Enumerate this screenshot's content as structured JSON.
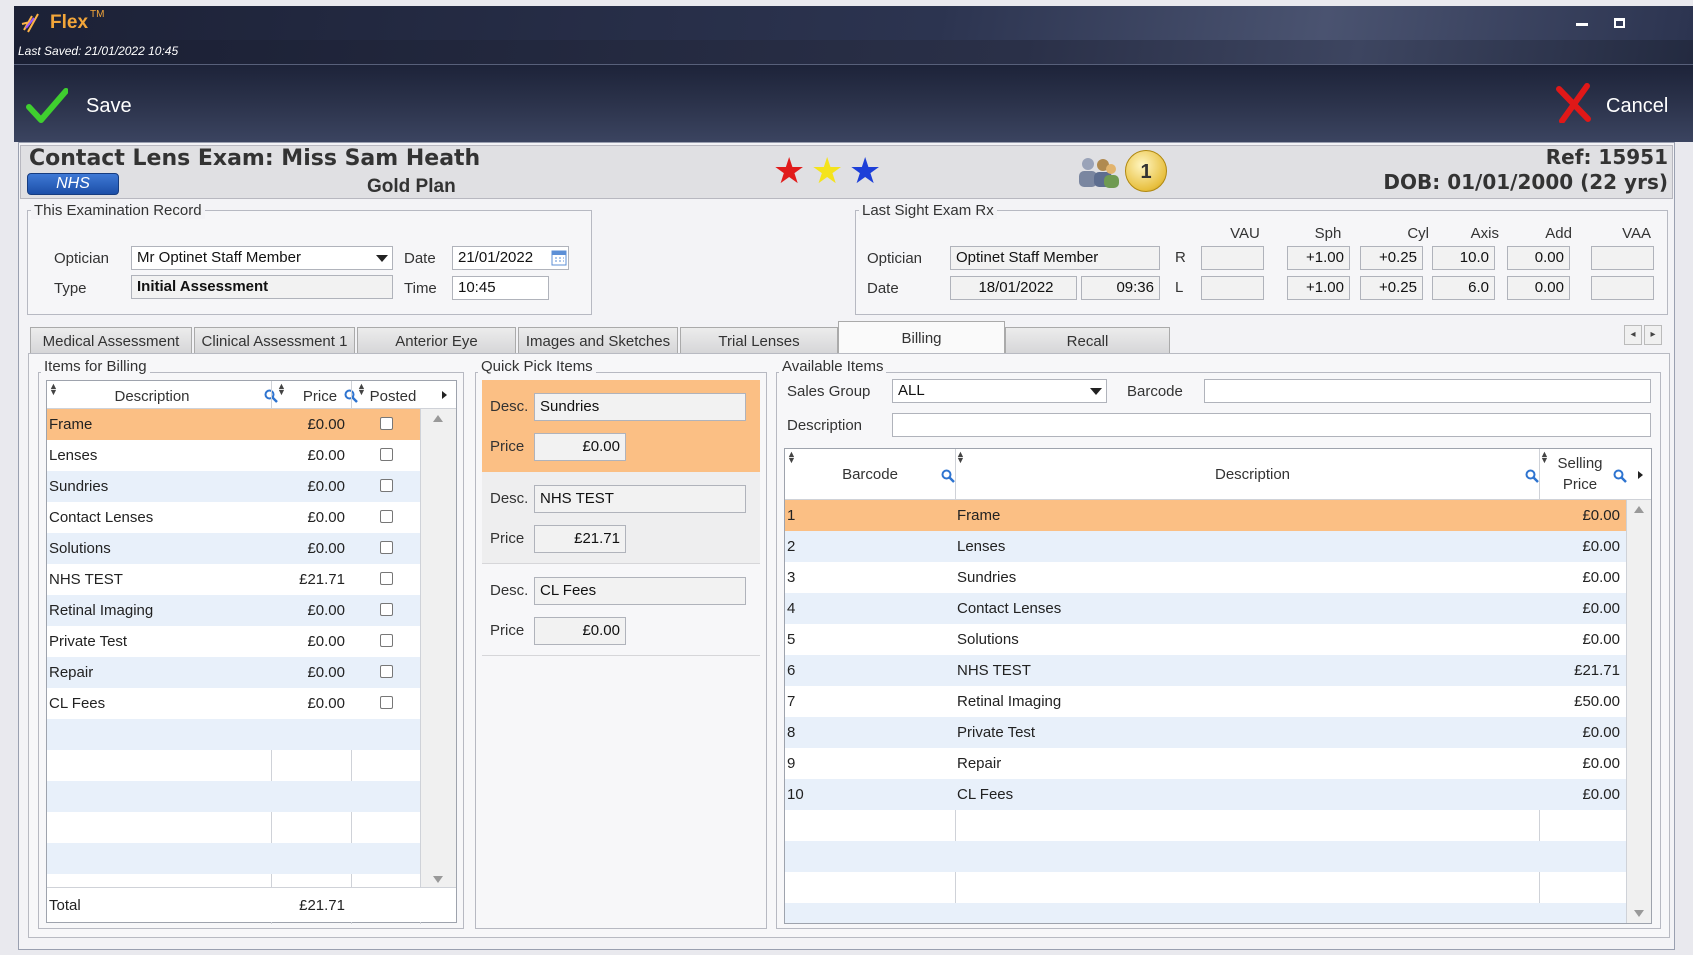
{
  "app": {
    "name": "Flex",
    "tm": "TM",
    "last_saved": "Last Saved: 21/01/2022 10:45"
  },
  "toolbar": {
    "save_label": "Save",
    "cancel_label": "Cancel"
  },
  "header": {
    "title": "Contact Lens Exam: Miss Sam Heath",
    "nhs_badge": "NHS",
    "plan": "Gold Plan",
    "alert_count": "1",
    "ref": "Ref: 15951",
    "dob": "DOB: 01/01/2000 (22 yrs)"
  },
  "exam_record": {
    "title": "This Examination Record",
    "optician_label": "Optician",
    "optician_value": "Mr Optinet Staff Member",
    "type_label": "Type",
    "type_value": "Initial Assessment",
    "date_label": "Date",
    "date_value": "21/01/2022",
    "time_label": "Time",
    "time_value": "10:45"
  },
  "sight_rx": {
    "title": "Last Sight Exam Rx",
    "optician_label": "Optician",
    "optician_value": "Optinet Staff Member",
    "date_label": "Date",
    "date_value": "18/01/2022",
    "time_value": "09:36",
    "columns": [
      "VAU",
      "Sph",
      "Cyl",
      "Axis",
      "Add",
      "VAA"
    ],
    "right": {
      "label": "R",
      "vau": "",
      "sph": "+1.00",
      "cyl": "+0.25",
      "axis": "10.0",
      "add": "0.00",
      "vaa": ""
    },
    "left": {
      "label": "L",
      "vau": "",
      "sph": "+1.00",
      "cyl": "+0.25",
      "axis": "6.0",
      "add": "0.00",
      "vaa": ""
    }
  },
  "tabs": [
    "Medical Assessment",
    "Clinical Assessment 1",
    "Anterior Eye",
    "Images and Sketches",
    "Trial Lenses",
    "Billing",
    "Recall"
  ],
  "billing": {
    "title": "Items for Billing",
    "headers": {
      "description": "Description",
      "price": "Price",
      "posted": "Posted"
    },
    "rows": [
      {
        "desc": "Frame",
        "price": "£0.00"
      },
      {
        "desc": "Lenses",
        "price": "£0.00"
      },
      {
        "desc": "Sundries",
        "price": "£0.00"
      },
      {
        "desc": "Contact Lenses",
        "price": "£0.00"
      },
      {
        "desc": "Solutions",
        "price": "£0.00"
      },
      {
        "desc": "NHS TEST",
        "price": "£21.71"
      },
      {
        "desc": "Retinal Imaging",
        "price": "£0.00"
      },
      {
        "desc": "Private Test",
        "price": "£0.00"
      },
      {
        "desc": "Repair",
        "price": "£0.00"
      },
      {
        "desc": "CL Fees",
        "price": "£0.00"
      }
    ],
    "total_label": "Total",
    "total_value": "£21.71"
  },
  "quick_pick": {
    "title": "Quick Pick Items",
    "desc_label": "Desc.",
    "price_label": "Price",
    "items": [
      {
        "desc": "Sundries",
        "price": "£0.00"
      },
      {
        "desc": "NHS TEST",
        "price": "£21.71"
      },
      {
        "desc": "CL Fees",
        "price": "£0.00"
      }
    ]
  },
  "available": {
    "title": "Available Items",
    "sales_group_label": "Sales Group",
    "sales_group_value": "ALL",
    "barcode_label": "Barcode",
    "barcode_value": "",
    "description_label": "Description",
    "description_value": "",
    "headers": {
      "barcode": "Barcode",
      "description": "Description",
      "selling": "Selling",
      "price": "Price"
    },
    "rows": [
      {
        "barcode": "1",
        "desc": "Frame",
        "price": "£0.00"
      },
      {
        "barcode": "2",
        "desc": "Lenses",
        "price": "£0.00"
      },
      {
        "barcode": "3",
        "desc": "Sundries",
        "price": "£0.00"
      },
      {
        "barcode": "4",
        "desc": "Contact Lenses",
        "price": "£0.00"
      },
      {
        "barcode": "5",
        "desc": "Solutions",
        "price": "£0.00"
      },
      {
        "barcode": "6",
        "desc": "NHS TEST",
        "price": "£21.71"
      },
      {
        "barcode": "7",
        "desc": "Retinal Imaging",
        "price": "£50.00"
      },
      {
        "barcode": "8",
        "desc": "Private Test",
        "price": "£0.00"
      },
      {
        "barcode": "9",
        "desc": "Repair",
        "price": "£0.00"
      },
      {
        "barcode": "10",
        "desc": "CL Fees",
        "price": "£0.00"
      }
    ]
  },
  "colors": {
    "highlight": "#fbbf84",
    "alt_row": "#e8f0fa",
    "accent_blue": "#1c4fa8"
  }
}
